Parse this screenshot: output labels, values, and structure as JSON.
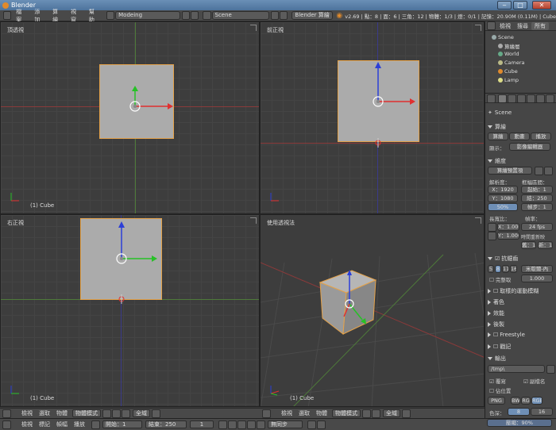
{
  "window": {
    "title": "Blender"
  },
  "window_buttons": {
    "minimize": "‒",
    "maximize": "□",
    "close": "✕"
  },
  "infobar": {
    "menus": [
      "檔案",
      "添加",
      "算繪",
      "視窗",
      "幫助"
    ],
    "layout": "Modeing",
    "scene": "Scene",
    "engine": "Blender 算繪",
    "stats": "v2.69 | 點：8 | 面：6 | 三角：12 | 物體：1/3 | 燈：0/1 | 記憶：20.90M (0.11M) | Cube"
  },
  "viewports": {
    "top_left": {
      "label": "頂透視",
      "object": "(1) Cube"
    },
    "top_right": {
      "label": "前正視",
      "object": ""
    },
    "bottom_left": {
      "label": "右正視",
      "object": "(1) Cube"
    },
    "bottom_right": {
      "label": "使用透視法",
      "object": "(1) Cube"
    }
  },
  "view_header": {
    "menus": [
      "檢視",
      "選取",
      "物體"
    ],
    "mode": "物體模式",
    "orientation": "全域"
  },
  "timeline": {
    "menus": [
      "檢視",
      "標記",
      "幀幅",
      "播放"
    ],
    "start_label": "開始：1",
    "end_label": "結束：250",
    "current": "1",
    "sync": "無同步"
  },
  "outliner": {
    "tabs": [
      "檢視",
      "搜尋",
      "所有"
    ],
    "items": [
      "Scene",
      "算繪層",
      "World",
      "Camera",
      "Cube",
      "Lamp"
    ]
  },
  "properties": {
    "scene_label": "Scene",
    "render_section": "算繪",
    "render_buttons": [
      "算繪",
      "動畫",
      "播放"
    ],
    "display_label": "顯示：",
    "display_value": "影像編輯器",
    "dimensions_section": "維度",
    "preset": "算繪預置項",
    "resolution_label": "解析度：",
    "frame_range_label": "框幅區間：",
    "res_x": "X：1920",
    "res_y": "Y：1080",
    "res_pct": "50%",
    "start": "起始：1",
    "end": "結：250",
    "step": "幀步：1",
    "aspect_label": "長寬比：",
    "framerate_label": "幀率：",
    "aspect_x": "X：1.000",
    "aspect_y": "Y：1.000",
    "fps": "24 fps",
    "time_remap_label": "時間重新映",
    "remap_old": "舊：1",
    "remap_new": "新：1",
    "aa_section": "抗鋸齒",
    "aa_values": [
      "5",
      "8",
      "11",
      "16"
    ],
    "aa_filter": "米歇爾-內",
    "full_sample": "完整取",
    "filter_size": "1.000",
    "collapsed_sections": [
      "取樣的運動模糊",
      "著色",
      "效能",
      "後製",
      "Freestyle",
      "戳記"
    ],
    "output_section": "輸出",
    "output_path": "/tmp\\",
    "overwrite": "覆寫",
    "file_ext": "副檔名",
    "placeholders": "佔位置",
    "format": "PNG",
    "color_modes": [
      "BW",
      "RG",
      "RGB"
    ],
    "color_depth_label": "色深：",
    "color_depth_8": "8",
    "color_depth_16": "16",
    "compression": "壓縮：90%"
  }
}
